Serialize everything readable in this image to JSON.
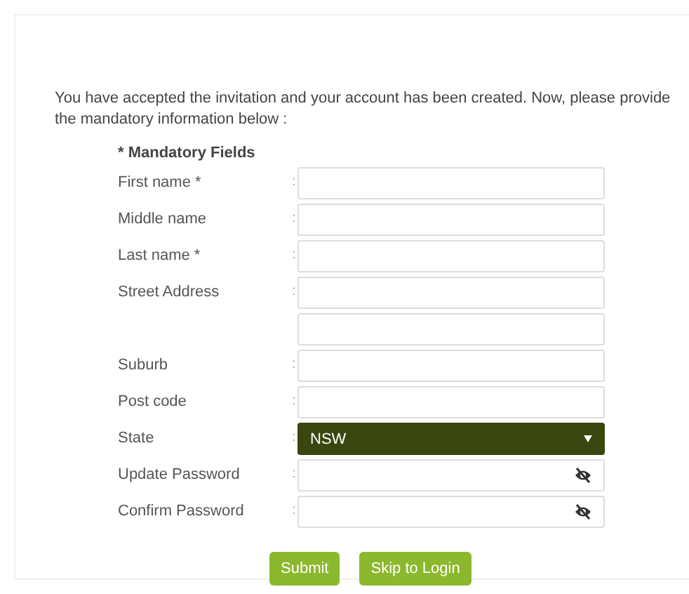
{
  "intro": "You have accepted the invitation and your account has been created. Now, please provide the mandatory information below :",
  "legend": "* Mandatory Fields",
  "fields": [
    {
      "kind": "text",
      "label": "First name *",
      "separator": ":"
    },
    {
      "kind": "text",
      "label": "Middle name",
      "separator": ":"
    },
    {
      "kind": "text",
      "label": "Last name *",
      "separator": ":"
    },
    {
      "kind": "text",
      "label": "Street Address",
      "separator": ":"
    },
    {
      "kind": "continuation"
    },
    {
      "kind": "text",
      "label": "Suburb",
      "separator": ":"
    },
    {
      "kind": "text",
      "label": "Post code",
      "separator": ":"
    },
    {
      "kind": "select",
      "label": "State",
      "separator": ":",
      "value": "NSW"
    },
    {
      "kind": "password",
      "label": "Update Password",
      "separator": ":"
    },
    {
      "kind": "password",
      "label": "Confirm Password",
      "separator": ":"
    }
  ],
  "buttons": [
    "Submit",
    "Skip to Login"
  ]
}
